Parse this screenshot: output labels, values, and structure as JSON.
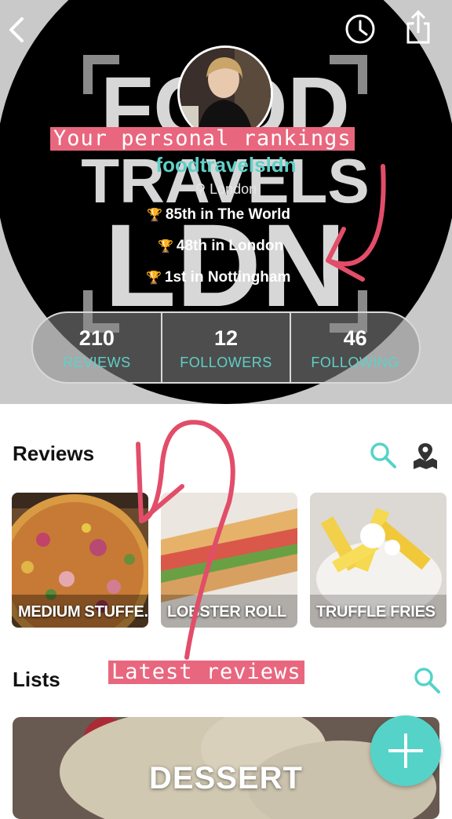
{
  "header": {
    "caption_top": "Your personal rankings",
    "username": "foodtravelsldn",
    "location": "London",
    "rankings": [
      "85th in The World",
      "48th in London",
      "1st in Nottingham"
    ],
    "stats": [
      {
        "value": "210",
        "label": "REVIEWS"
      },
      {
        "value": "12",
        "label": "FOLLOWERS"
      },
      {
        "value": "46",
        "label": "FOLLOWING"
      }
    ],
    "icons": {
      "back": "chevron-left-icon",
      "history": "clock-icon",
      "share": "share-icon",
      "location": "map-pin-icon",
      "ranking": "trophy-icon"
    }
  },
  "reviews": {
    "title": "Reviews",
    "items": [
      {
        "title": "MEDIUM STUFFE..."
      },
      {
        "title": "LOBSTER ROLL"
      },
      {
        "title": "TRUFFLE FRIES"
      }
    ]
  },
  "lists": {
    "title": "Lists",
    "caption": "Latest reviews",
    "items": [
      {
        "title": "DESSERT"
      }
    ]
  },
  "colors": {
    "accent": "#55d3c8",
    "highlight": "#e8677e",
    "header_bg": "#c9c9c9"
  }
}
